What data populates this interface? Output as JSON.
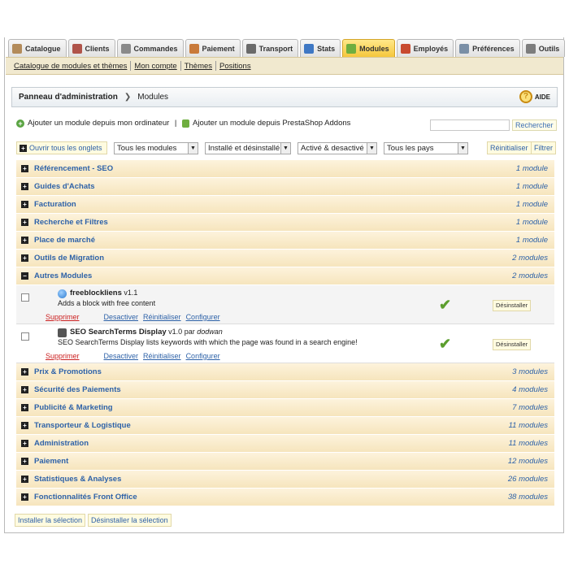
{
  "tabs": [
    {
      "label": "Catalogue",
      "icon": "book-icon",
      "color": "#b38b5a"
    },
    {
      "label": "Clients",
      "icon": "user-icon",
      "color": "#b0544a"
    },
    {
      "label": "Commandes",
      "icon": "cart-icon",
      "color": "#8a8a8a"
    },
    {
      "label": "Paiement",
      "icon": "money-icon",
      "color": "#c97a3a"
    },
    {
      "label": "Transport",
      "icon": "truck-icon",
      "color": "#6a6a6a"
    },
    {
      "label": "Stats",
      "icon": "bar-chart-icon",
      "color": "#3f78c4"
    },
    {
      "label": "Modules",
      "icon": "puzzle-icon",
      "color": "#6fae3f",
      "active": true
    },
    {
      "label": "Employés",
      "icon": "employee-icon",
      "color": "#c84a2f"
    },
    {
      "label": "Préférences",
      "icon": "settings-icon",
      "color": "#7a8fa6"
    },
    {
      "label": "Outils",
      "icon": "wrench-icon",
      "color": "#7d7d7d"
    }
  ],
  "subnav": [
    "Catalogue de modules et thèmes",
    "Mon compte",
    "Thèmes",
    "Positions"
  ],
  "breadcrumb": {
    "root": "Panneau d'administration",
    "current": "Modules"
  },
  "help_label": "AIDE",
  "add_local": "Ajouter un module depuis mon ordinateur",
  "add_addons": "Ajouter un module depuis PrestaShop Addons",
  "search": {
    "value": "",
    "button": "Rechercher"
  },
  "filters": {
    "open_all": "Ouvrir tous les onglets",
    "modules": "Tous les modules",
    "install": "Installé et désinstallé",
    "active": "Activé & desactivé",
    "country": "Tous les pays",
    "reset": "Réinitialiser",
    "filter": "Filtrer"
  },
  "categories_top": [
    {
      "name": "Référencement - SEO",
      "count": "1 module"
    },
    {
      "name": "Guides d'Achats",
      "count": "1 module"
    },
    {
      "name": "Facturation",
      "count": "1 module"
    },
    {
      "name": "Recherche et Filtres",
      "count": "1 module"
    },
    {
      "name": "Place de marché",
      "count": "1 module"
    },
    {
      "name": "Outils de Migration",
      "count": "2 modules"
    }
  ],
  "open_category": {
    "name": "Autres Modules",
    "count": "2 modules"
  },
  "modules": [
    {
      "name": "freeblockliens",
      "version": "v1.1",
      "author_prefix": "",
      "author": "",
      "desc": "Adds a block with free content",
      "delete": "Supprimer",
      "deactivate": "Desactiver",
      "reset": "Réinitialiser",
      "configure": "Configurer",
      "uninstall": "Désinstaller",
      "installed": true
    },
    {
      "name": "SEO SearchTerms Display",
      "version": "v1.0",
      "author_prefix": "par",
      "author": "dodwan",
      "desc": "SEO SearchTerms Display lists keywords with which the page was found in a search engine!",
      "delete": "Supprimer",
      "deactivate": "Desactiver",
      "reset": "Réinitialiser",
      "configure": "Configurer",
      "uninstall": "Désinstaller",
      "installed": true
    }
  ],
  "categories_bottom": [
    {
      "name": "Prix & Promotions",
      "count": "3 modules"
    },
    {
      "name": "Sécurité des Paiements",
      "count": "4 modules"
    },
    {
      "name": "Publicité & Marketing",
      "count": "7 modules"
    },
    {
      "name": "Transporteur & Logistique",
      "count": "11 modules"
    },
    {
      "name": "Administration",
      "count": "11 modules"
    },
    {
      "name": "Paiement",
      "count": "12 modules"
    },
    {
      "name": "Statistiques & Analyses",
      "count": "26 modules"
    },
    {
      "name": "Fonctionnalités Front Office",
      "count": "38 modules"
    }
  ],
  "bottom_buttons": {
    "install": "Installer la sélection",
    "uninstall": "Désinstaller la sélection"
  }
}
